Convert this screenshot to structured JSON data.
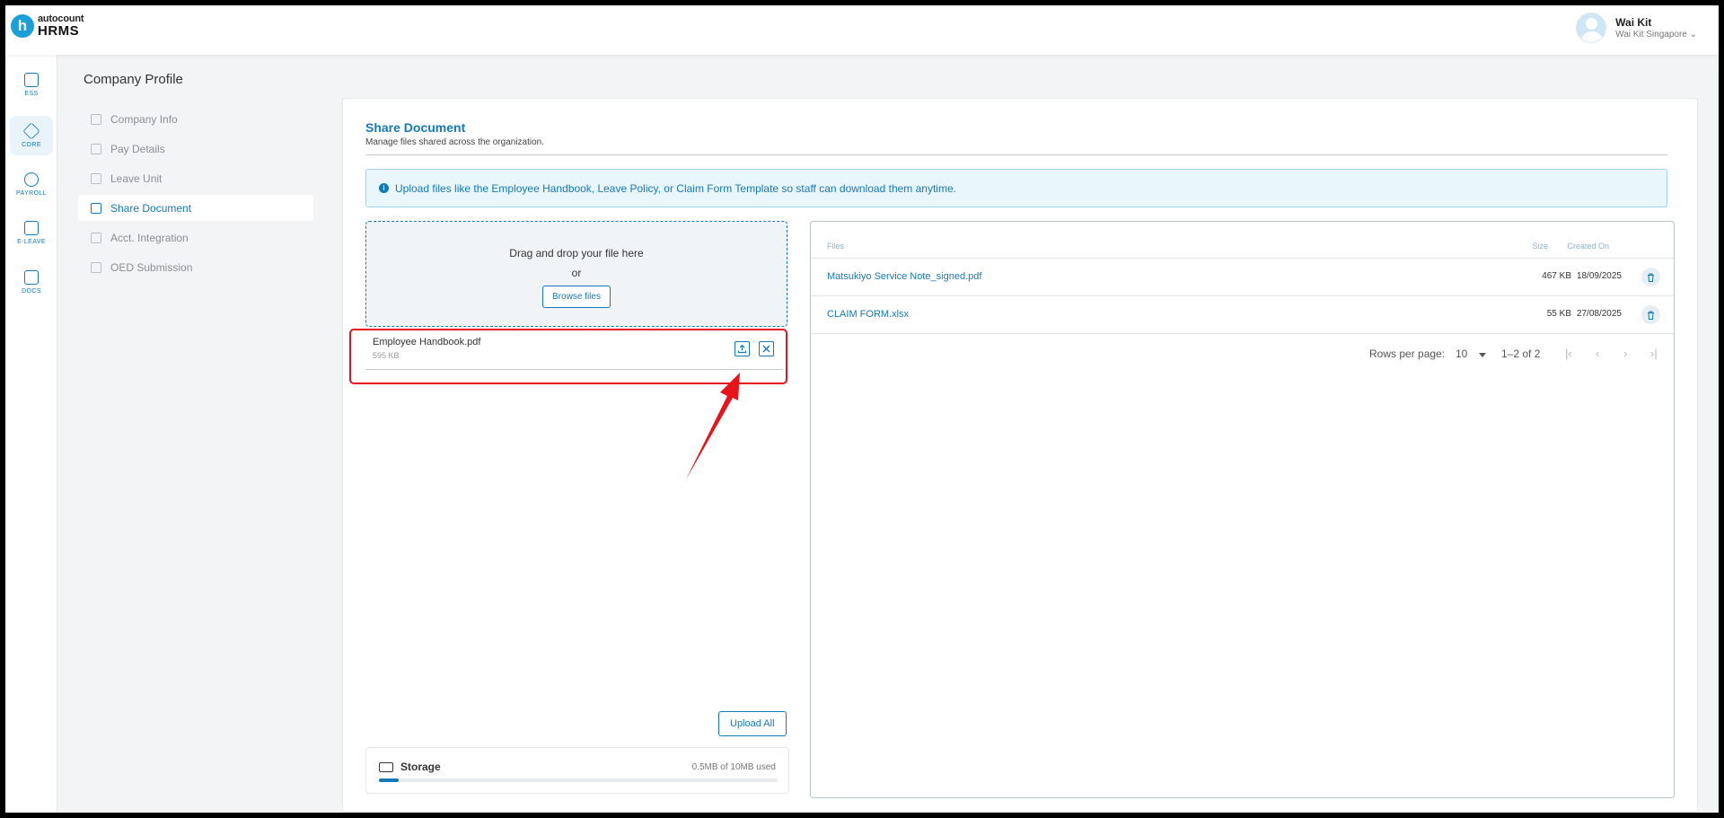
{
  "app": {
    "logo_letter": "h",
    "logo_small": "autocount",
    "logo_big": "HRMS"
  },
  "user": {
    "name": "Wai Kit",
    "company": "Wai Kit Singapore ⌄"
  },
  "rail": [
    {
      "label": "ESS",
      "icon": "ess-icon"
    },
    {
      "label": "CORE",
      "icon": "core-icon"
    },
    {
      "label": "PAYROLL",
      "icon": "payroll-icon"
    },
    {
      "label": "E-LEAVE",
      "icon": "calendar-icon"
    },
    {
      "label": "DOCS",
      "icon": "docs-icon"
    }
  ],
  "page": {
    "title": "Company Profile"
  },
  "subnav": [
    {
      "label": "Company Info"
    },
    {
      "label": "Pay Details"
    },
    {
      "label": "Leave Unit"
    },
    {
      "label": "Share Document"
    },
    {
      "label": "Acct. Integration"
    },
    {
      "label": "OED Submission"
    }
  ],
  "share": {
    "title": "Share Document",
    "subtitle": "Manage files shared across the organization.",
    "info": "Upload files like the Employee Handbook, Leave Policy, or Claim Form Template so staff can download them anytime.",
    "dropzone_title": "Drag and drop your file here",
    "dropzone_or": "or",
    "browse_label": "Browse files",
    "pending_file": {
      "name": "Employee Handbook.pdf",
      "size": "595 KB"
    },
    "upload_all_label": "Upload All",
    "storage_label": "Storage",
    "storage_used": "0.5MB of 10MB used",
    "storage_fraction": 0.05
  },
  "files_table": {
    "headers": {
      "files": "Files",
      "size": "Size",
      "created": "Created On"
    },
    "rows": [
      {
        "name": "Matsukiyo Service Note_signed.pdf",
        "size": "467 KB",
        "created": "18/09/2025"
      },
      {
        "name": "CLAIM FORM.xlsx",
        "size": "55 KB",
        "created": "27/08/2025"
      }
    ],
    "pagination": {
      "rows_per_page_label": "Rows per page:",
      "rows_per_page": "10",
      "range": "1–2 of 2",
      "first": "|‹",
      "prev": "‹",
      "next": "›",
      "last": "›|"
    }
  },
  "colors": {
    "accent": "#1479b8",
    "highlight": "#e8131b"
  }
}
